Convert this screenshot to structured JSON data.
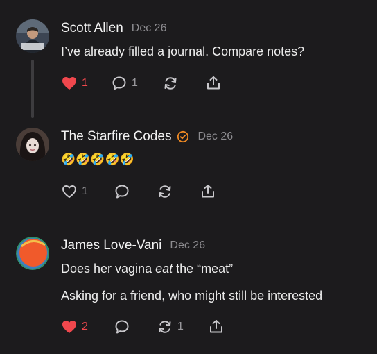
{
  "colors": {
    "background": "#1c1b1d",
    "like_active": "#f0474d",
    "muted": "#8d8c90",
    "verified": "#f08a24"
  },
  "posts": [
    {
      "author": "Scott Allen",
      "date": "Dec 26",
      "verified": false,
      "lines": [
        "I’ve already filled a journal. Compare notes?"
      ],
      "likes": "1",
      "liked": true,
      "replies": "1",
      "reposts": ""
    },
    {
      "author": "The Starfire Codes",
      "date": "Dec 26",
      "verified": true,
      "lines": [
        "🤣🤣🤣🤣🤣"
      ],
      "likes": "1",
      "liked": false,
      "replies": "",
      "reposts": ""
    },
    {
      "author": "James Love-Vani",
      "date": "Dec 26",
      "verified": false,
      "line_parts": [
        "Does her vagina ",
        "eat",
        " the “meat”"
      ],
      "lines": [
        "Asking for a friend, who might still be interested"
      ],
      "likes": "2",
      "liked": true,
      "replies": "",
      "reposts": "1"
    }
  ],
  "icons": [
    "heart-icon",
    "comment-icon",
    "repost-icon",
    "share-icon",
    "verified-check-icon"
  ]
}
